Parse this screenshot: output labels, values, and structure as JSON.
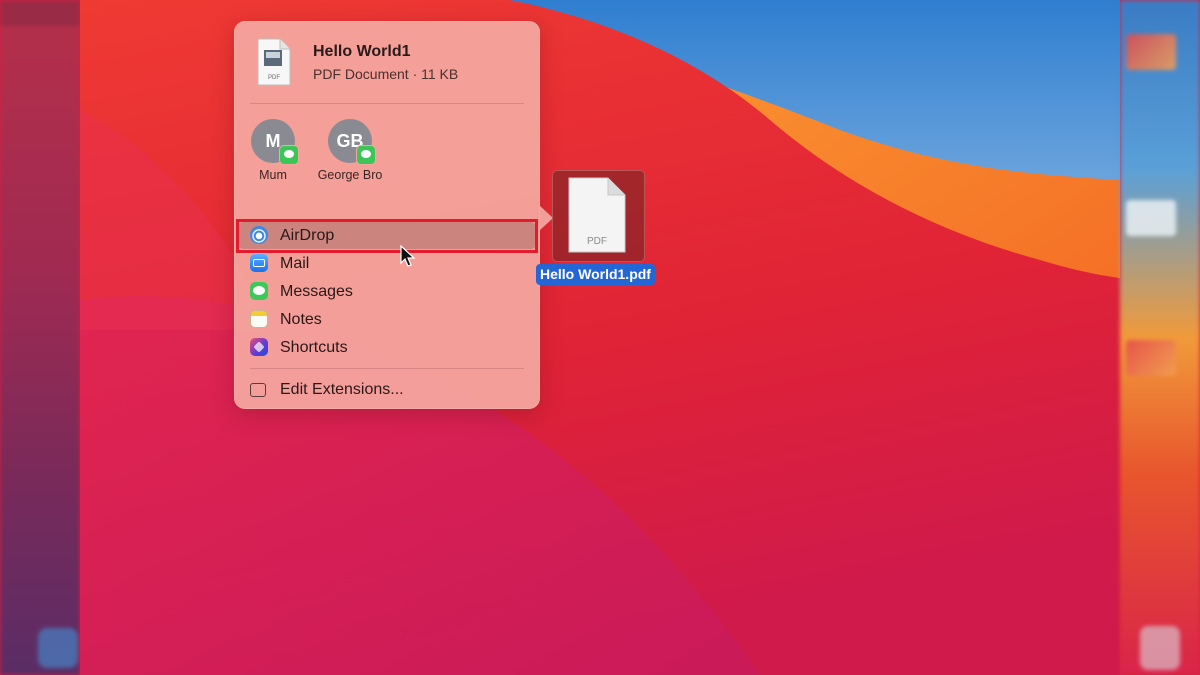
{
  "share_menu": {
    "document": {
      "title": "Hello World1",
      "subtitle": "PDF Document · 11 KB",
      "icon": "pdf-document-icon",
      "icon_text": "PDF"
    },
    "contacts": [
      {
        "initials": "M",
        "name": "Mum",
        "badge": "messages-badge-icon"
      },
      {
        "initials": "GB",
        "name": "George Bro",
        "badge": "messages-badge-icon"
      }
    ],
    "items": [
      {
        "label": "AirDrop",
        "icon": "airdrop-icon",
        "highlighted": true
      },
      {
        "label": "Mail",
        "icon": "mail-icon"
      },
      {
        "label": "Messages",
        "icon": "messages-icon"
      },
      {
        "label": "Notes",
        "icon": "notes-icon"
      },
      {
        "label": "Shortcuts",
        "icon": "shortcuts-icon"
      }
    ],
    "edit_extensions": {
      "label": "Edit Extensions...",
      "icon": "extensions-icon"
    }
  },
  "desktop_file": {
    "name": "Hello World1.pdf",
    "icon": "pdf-file-icon",
    "icon_text": "PDF"
  },
  "colors": {
    "highlight_border": "#e31b2d",
    "selection_blue": "#2466d4",
    "menu_background": "#f4a8a0"
  }
}
